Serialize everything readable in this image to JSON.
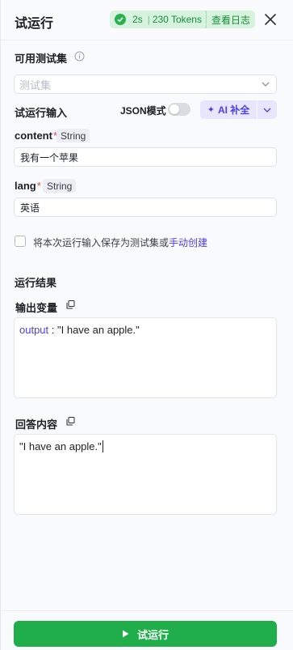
{
  "header": {
    "title": "试运行",
    "badge": {
      "time": "2s",
      "separator": "|",
      "tokens": "230 Tokens",
      "log_link": "查看日志"
    }
  },
  "testset": {
    "label": "可用测试集",
    "placeholder": "测试集"
  },
  "input_section": {
    "label": "试运行输入",
    "json_mode_label": "JSON模式",
    "json_mode_on": false,
    "ai_button": "AI 补全"
  },
  "fields": [
    {
      "name": "content",
      "required_mark": "*",
      "type": "String",
      "value": "我有一个苹果"
    },
    {
      "name": "lang",
      "required_mark": "*",
      "type": "String",
      "value": "英语"
    }
  ],
  "save_option": {
    "text": "将本次运行输入保存为测试集或",
    "link": "手动创建",
    "checked": false
  },
  "results": {
    "label": "运行结果",
    "output_var": {
      "label": "输出变量",
      "key": "output",
      "separator": " : ",
      "value": "\"I have an apple.\""
    },
    "answer": {
      "label": "回答内容",
      "value": "\"I have an apple.\""
    }
  },
  "footer": {
    "run_button": "试运行"
  },
  "colors": {
    "accent": "#4d3ee6",
    "success": "#1fae4a",
    "badge_bg": "#d6f3dd"
  }
}
